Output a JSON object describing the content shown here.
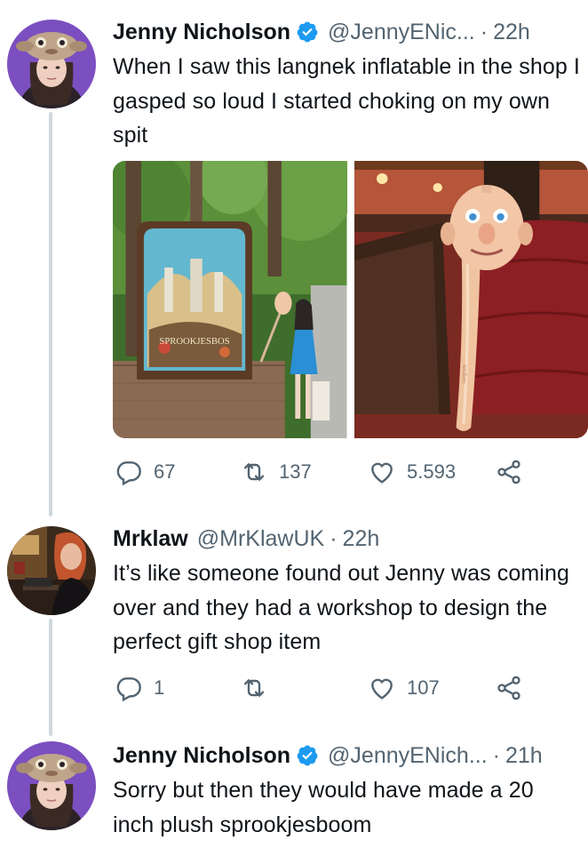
{
  "tweets": [
    {
      "name": "Jenny Nicholson",
      "handle": "@JennyENic...",
      "dot": "·",
      "time": "22h",
      "text": "When I saw this langnek inflatable in the shop I gasped so loud I started choking on my own spit",
      "media": [
        {
          "sign_text": "SPROOKJESBOS"
        },
        {
          "toy_label": "langnek"
        }
      ],
      "actions": {
        "reply_count": "67",
        "retweet_count": "137",
        "like_count": "5.593"
      }
    },
    {
      "name": "Mrklaw",
      "handle": "@MrKlawUK",
      "dot": "·",
      "time": "22h",
      "text": "It’s like someone found out Jenny was coming over and they had a workshop to design the perfect gift shop item",
      "actions": {
        "reply_count": "1",
        "retweet_count": "",
        "like_count": "107"
      }
    },
    {
      "name": "Jenny Nicholson",
      "handle": "@JennyENich...",
      "dot": "·",
      "time": "21h",
      "text": "Sorry but then they would have made a 20 inch plush sprookjesboom"
    }
  ],
  "colors": {
    "verified": "#1d9bf0",
    "thread_line": "#cfd9de",
    "secondary_text": "#536471",
    "avatar_bg": "#7b4fc0"
  },
  "icons": [
    "verified-badge-icon",
    "reply-icon",
    "retweet-icon",
    "like-icon",
    "share-icon"
  ]
}
